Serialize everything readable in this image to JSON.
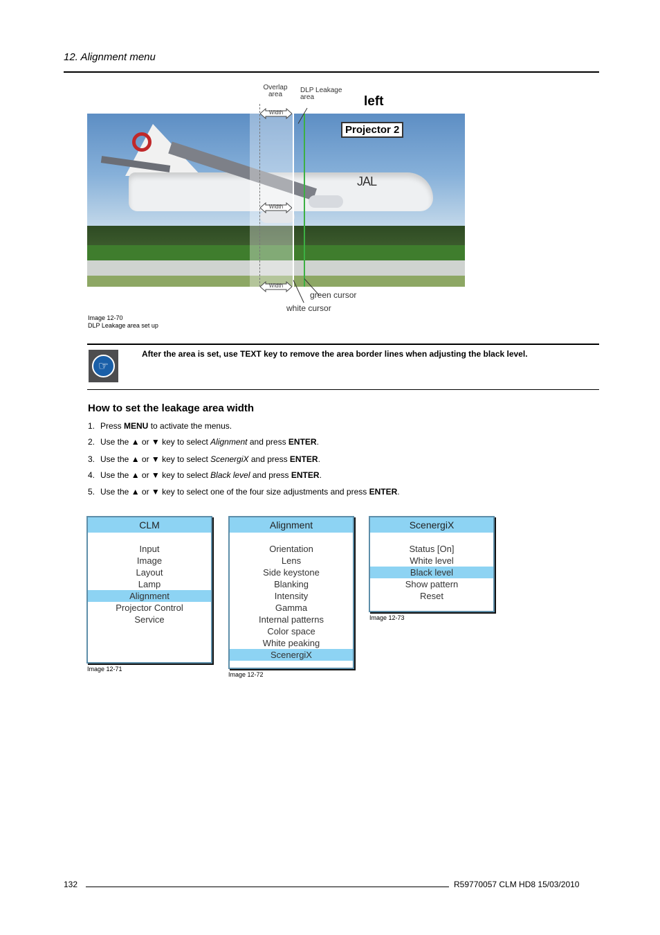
{
  "header": {
    "chapter_title": "12.  Alignment menu"
  },
  "figure_main": {
    "labels": {
      "overlap_area": "Overlap area",
      "dlp_leakage_area": "DLP Leakage area",
      "side": "left",
      "projector": "Projector 2",
      "width_arrow": "Width",
      "green_cursor": "green cursor",
      "white_cursor": "white cursor",
      "tail_text": "JAL"
    },
    "caption": {
      "number": "Image 12-70",
      "title": "DLP Leakage area set up"
    }
  },
  "note": {
    "icon": "pointing-hand-icon",
    "text": "After the area is set, use TEXT key to remove the area border lines when adjusting the black level."
  },
  "section": {
    "heading": "How to set the leakage area width",
    "steps": [
      {
        "num": "1.",
        "parts": [
          {
            "t": "Press "
          },
          {
            "t": "MENU",
            "b": true
          },
          {
            "t": " to activate the menus."
          }
        ]
      },
      {
        "num": "2.",
        "parts": [
          {
            "t": "Use the ▲ or ▼ key to select "
          },
          {
            "t": "Alignment",
            "i": true
          },
          {
            "t": " and press "
          },
          {
            "t": "ENTER",
            "b": true
          },
          {
            "t": "."
          }
        ]
      },
      {
        "num": "3.",
        "parts": [
          {
            "t": "Use the ▲ or ▼ key to select "
          },
          {
            "t": "ScenergiX",
            "i": true
          },
          {
            "t": " and press "
          },
          {
            "t": "ENTER",
            "b": true
          },
          {
            "t": "."
          }
        ]
      },
      {
        "num": "4.",
        "parts": [
          {
            "t": "Use the ▲ or ▼ key to select "
          },
          {
            "t": "Black level",
            "i": true
          },
          {
            "t": " and press "
          },
          {
            "t": "ENTER",
            "b": true
          },
          {
            "t": "."
          }
        ]
      },
      {
        "num": "5.",
        "parts": [
          {
            "t": "Use the ▲ or ▼ key to select one of the four size adjustments and press "
          },
          {
            "t": "ENTER",
            "b": true
          },
          {
            "t": "."
          }
        ]
      }
    ]
  },
  "menus": [
    {
      "title": "CLM",
      "items": [
        "Input",
        "Image",
        "Layout",
        "Lamp",
        "Alignment",
        "Projector Control",
        "Service"
      ],
      "selected": "Alignment",
      "caption": "Image 12-71"
    },
    {
      "title": "Alignment",
      "items": [
        "Orientation",
        "Lens",
        "Side keystone",
        "Blanking",
        "Intensity",
        "Gamma",
        "Internal patterns",
        "Color space",
        "White peaking",
        "ScenergiX"
      ],
      "selected": "ScenergiX",
      "caption": "Image 12-72"
    },
    {
      "title": "ScenergiX",
      "items": [
        "Status [On]",
        "White level",
        "Black level",
        "Show pattern",
        "Reset"
      ],
      "selected": "Black level",
      "caption": "Image 12-73"
    }
  ],
  "footer": {
    "page_number": "132",
    "doc_info": "R59770057   CLM HD8  15/03/2010"
  }
}
